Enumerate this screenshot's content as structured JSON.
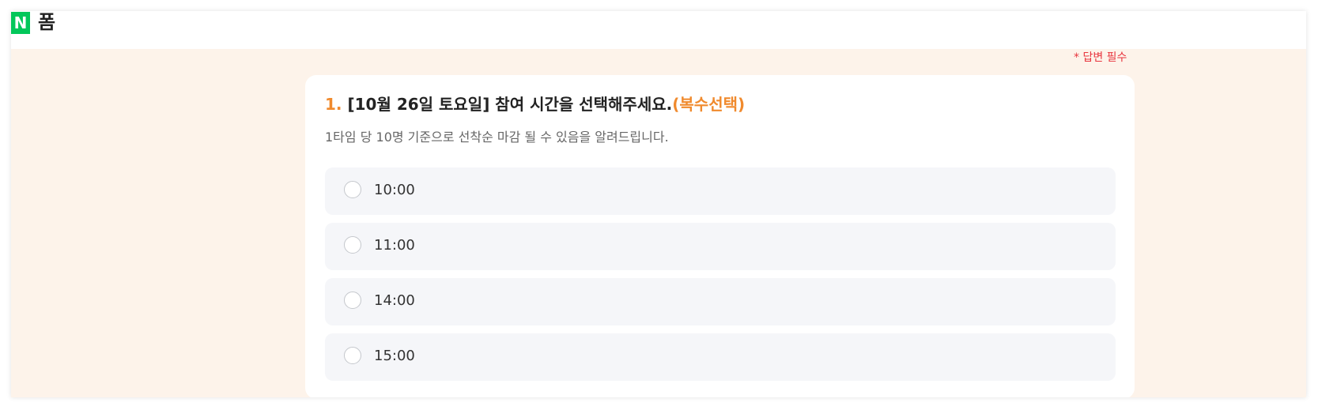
{
  "header": {
    "logo": "N",
    "title": "폼"
  },
  "form": {
    "required_note": "* 답변 필수",
    "question": {
      "number": "1.",
      "title": " [10월 26일 토요일] 참여 시간을 선택해주세요.",
      "multi": "(복수선택)",
      "description": "1타임 당 10명 기준으로 선착순 마감 될 수 있음을 알려드립니다.",
      "options": [
        {
          "label": "10:00",
          "selected": false
        },
        {
          "label": "11:00",
          "selected": false
        },
        {
          "label": "14:00",
          "selected": false
        },
        {
          "label": "15:00",
          "selected": false
        }
      ]
    }
  },
  "colors": {
    "brand_green": "#03c75a",
    "accent_orange": "#f08a2d",
    "required_red": "#e8363f",
    "page_background": "#fdf3ea",
    "option_background": "#f5f6f9"
  }
}
